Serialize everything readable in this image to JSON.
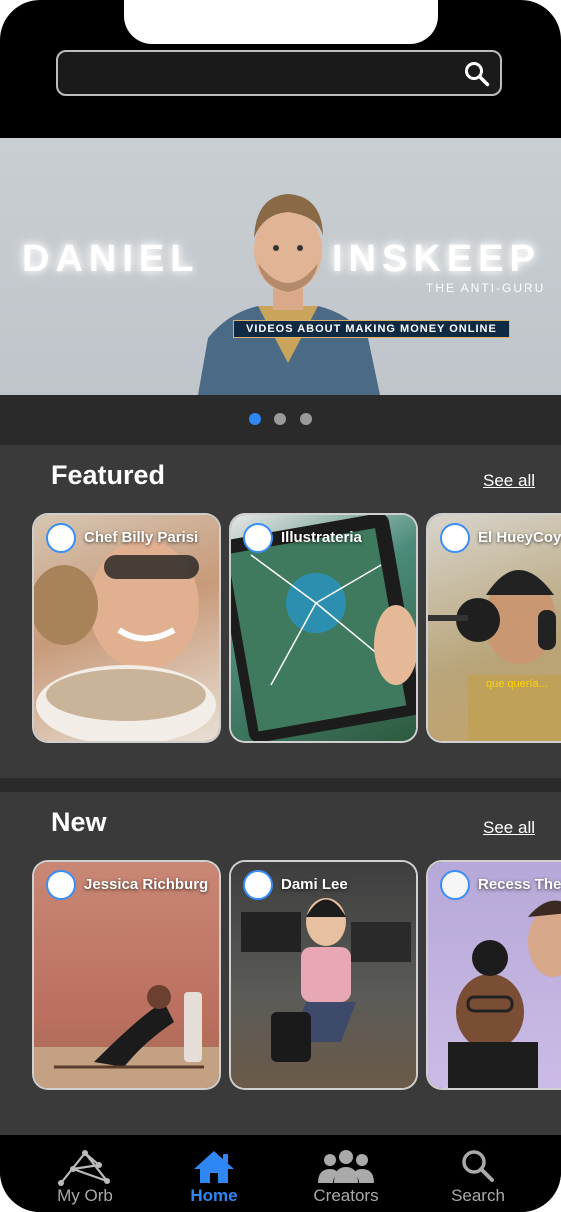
{
  "search": {
    "placeholder": "",
    "value": ""
  },
  "banner": {
    "name_left": "DANIEL",
    "name_right": "INSKEEP",
    "subtitle": "THE ANTI-GURU",
    "tagline": "VIDEOS ABOUT MAKING MONEY ONLINE",
    "pages": 3,
    "active_page": 1
  },
  "featured": {
    "title": "Featured",
    "see_all": "See all",
    "cards": [
      {
        "name": "Chef Billy Parisi"
      },
      {
        "name": "Illustrateria"
      },
      {
        "name": "El HueyCoyote",
        "caption": "que quería..."
      }
    ]
  },
  "new": {
    "title": "New",
    "see_all": "See all",
    "cards": [
      {
        "name": "Jessica Richburg"
      },
      {
        "name": "Dami Lee"
      },
      {
        "name": "Recess Therapy",
        "avatar_text": "Recess Therapy"
      }
    ]
  },
  "tabs": [
    {
      "label": "My Orb",
      "icon": "orb-icon",
      "active": false
    },
    {
      "label": "Home",
      "icon": "home-icon",
      "active": true
    },
    {
      "label": "Creators",
      "icon": "people-icon",
      "active": false
    },
    {
      "label": "Search",
      "icon": "search-icon",
      "active": false
    }
  ],
  "colors": {
    "accent": "#2f86f5",
    "background": "#3a3a3a"
  }
}
